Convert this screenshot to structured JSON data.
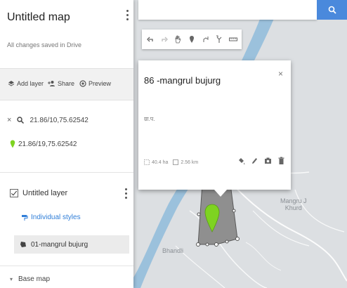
{
  "panel": {
    "title": "Untitled map",
    "saved_status": "All changes saved in Drive",
    "actions": {
      "add_layer": "Add layer",
      "share": "Share",
      "preview": "Preview"
    },
    "search_query": "21.86/10,75.62542",
    "result_label": "21.86/19,75.62542",
    "layer": {
      "name": "Untitled layer",
      "styles_link": "Individual styles",
      "feature": "01-mangrul bujurg"
    },
    "base_map_label": "Base map"
  },
  "popup": {
    "title": "86 -mangrul bujurg",
    "description": "ग्रा.प.",
    "area": "40.4 ha",
    "perimeter": "2.56 km",
    "close": "×"
  },
  "map": {
    "labels": {
      "village_a": "Mangru J",
      "village_a_line2": "Khurd",
      "village_b": "Bhandli"
    }
  },
  "colors": {
    "accent": "#4a89dc",
    "marker": "#7ed321",
    "river": "#9bc1dc",
    "land": "#dcdfe2",
    "polygon": "#8f8f8f"
  },
  "icons": {
    "search": "search-icon",
    "undo": "undo-icon",
    "redo": "redo-icon",
    "hand": "hand-icon",
    "marker": "marker-icon",
    "draw_line": "draw-line-icon",
    "route": "route-icon",
    "ruler": "ruler-icon"
  }
}
